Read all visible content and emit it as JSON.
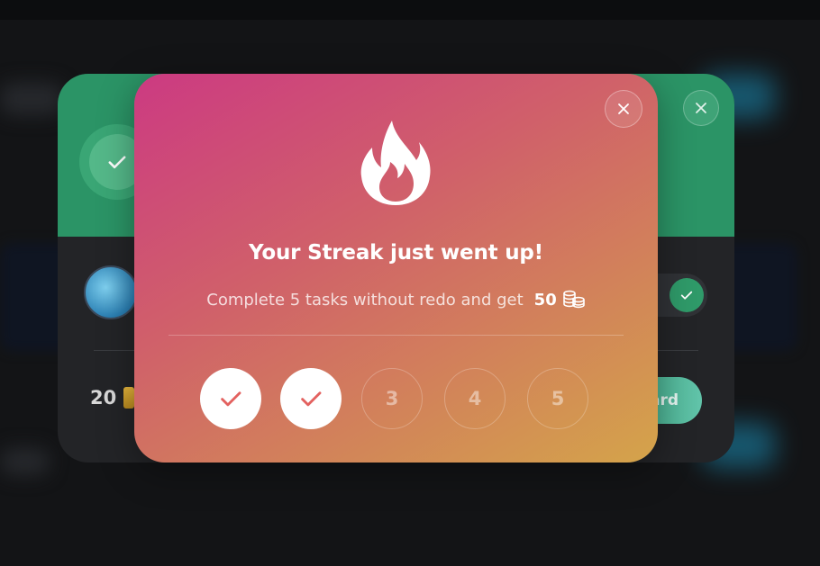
{
  "modal": {
    "title": "Your Streak just went up!",
    "subtitle": "Complete 5 tasks without redo and get",
    "reward_amount": "50",
    "icons": {
      "flame": "flame-icon",
      "coins": "coins-icon",
      "close": "close-icon"
    },
    "steps": [
      {
        "label": "",
        "status": "done",
        "icon": "check-icon"
      },
      {
        "label": "",
        "status": "done",
        "icon": "check-icon"
      },
      {
        "label": "3",
        "status": "pending"
      },
      {
        "label": "4",
        "status": "pending"
      },
      {
        "label": "5",
        "status": "pending"
      }
    ],
    "colors": {
      "gradient_start": "#cc3a82",
      "gradient_mid": "#d0606a",
      "gradient_end": "#d4a44a",
      "check": "#e3615f"
    }
  },
  "background_card": {
    "amount": "20",
    "claim_label": "ard",
    "header_color": "#2b9466",
    "card_color": "#232427"
  }
}
